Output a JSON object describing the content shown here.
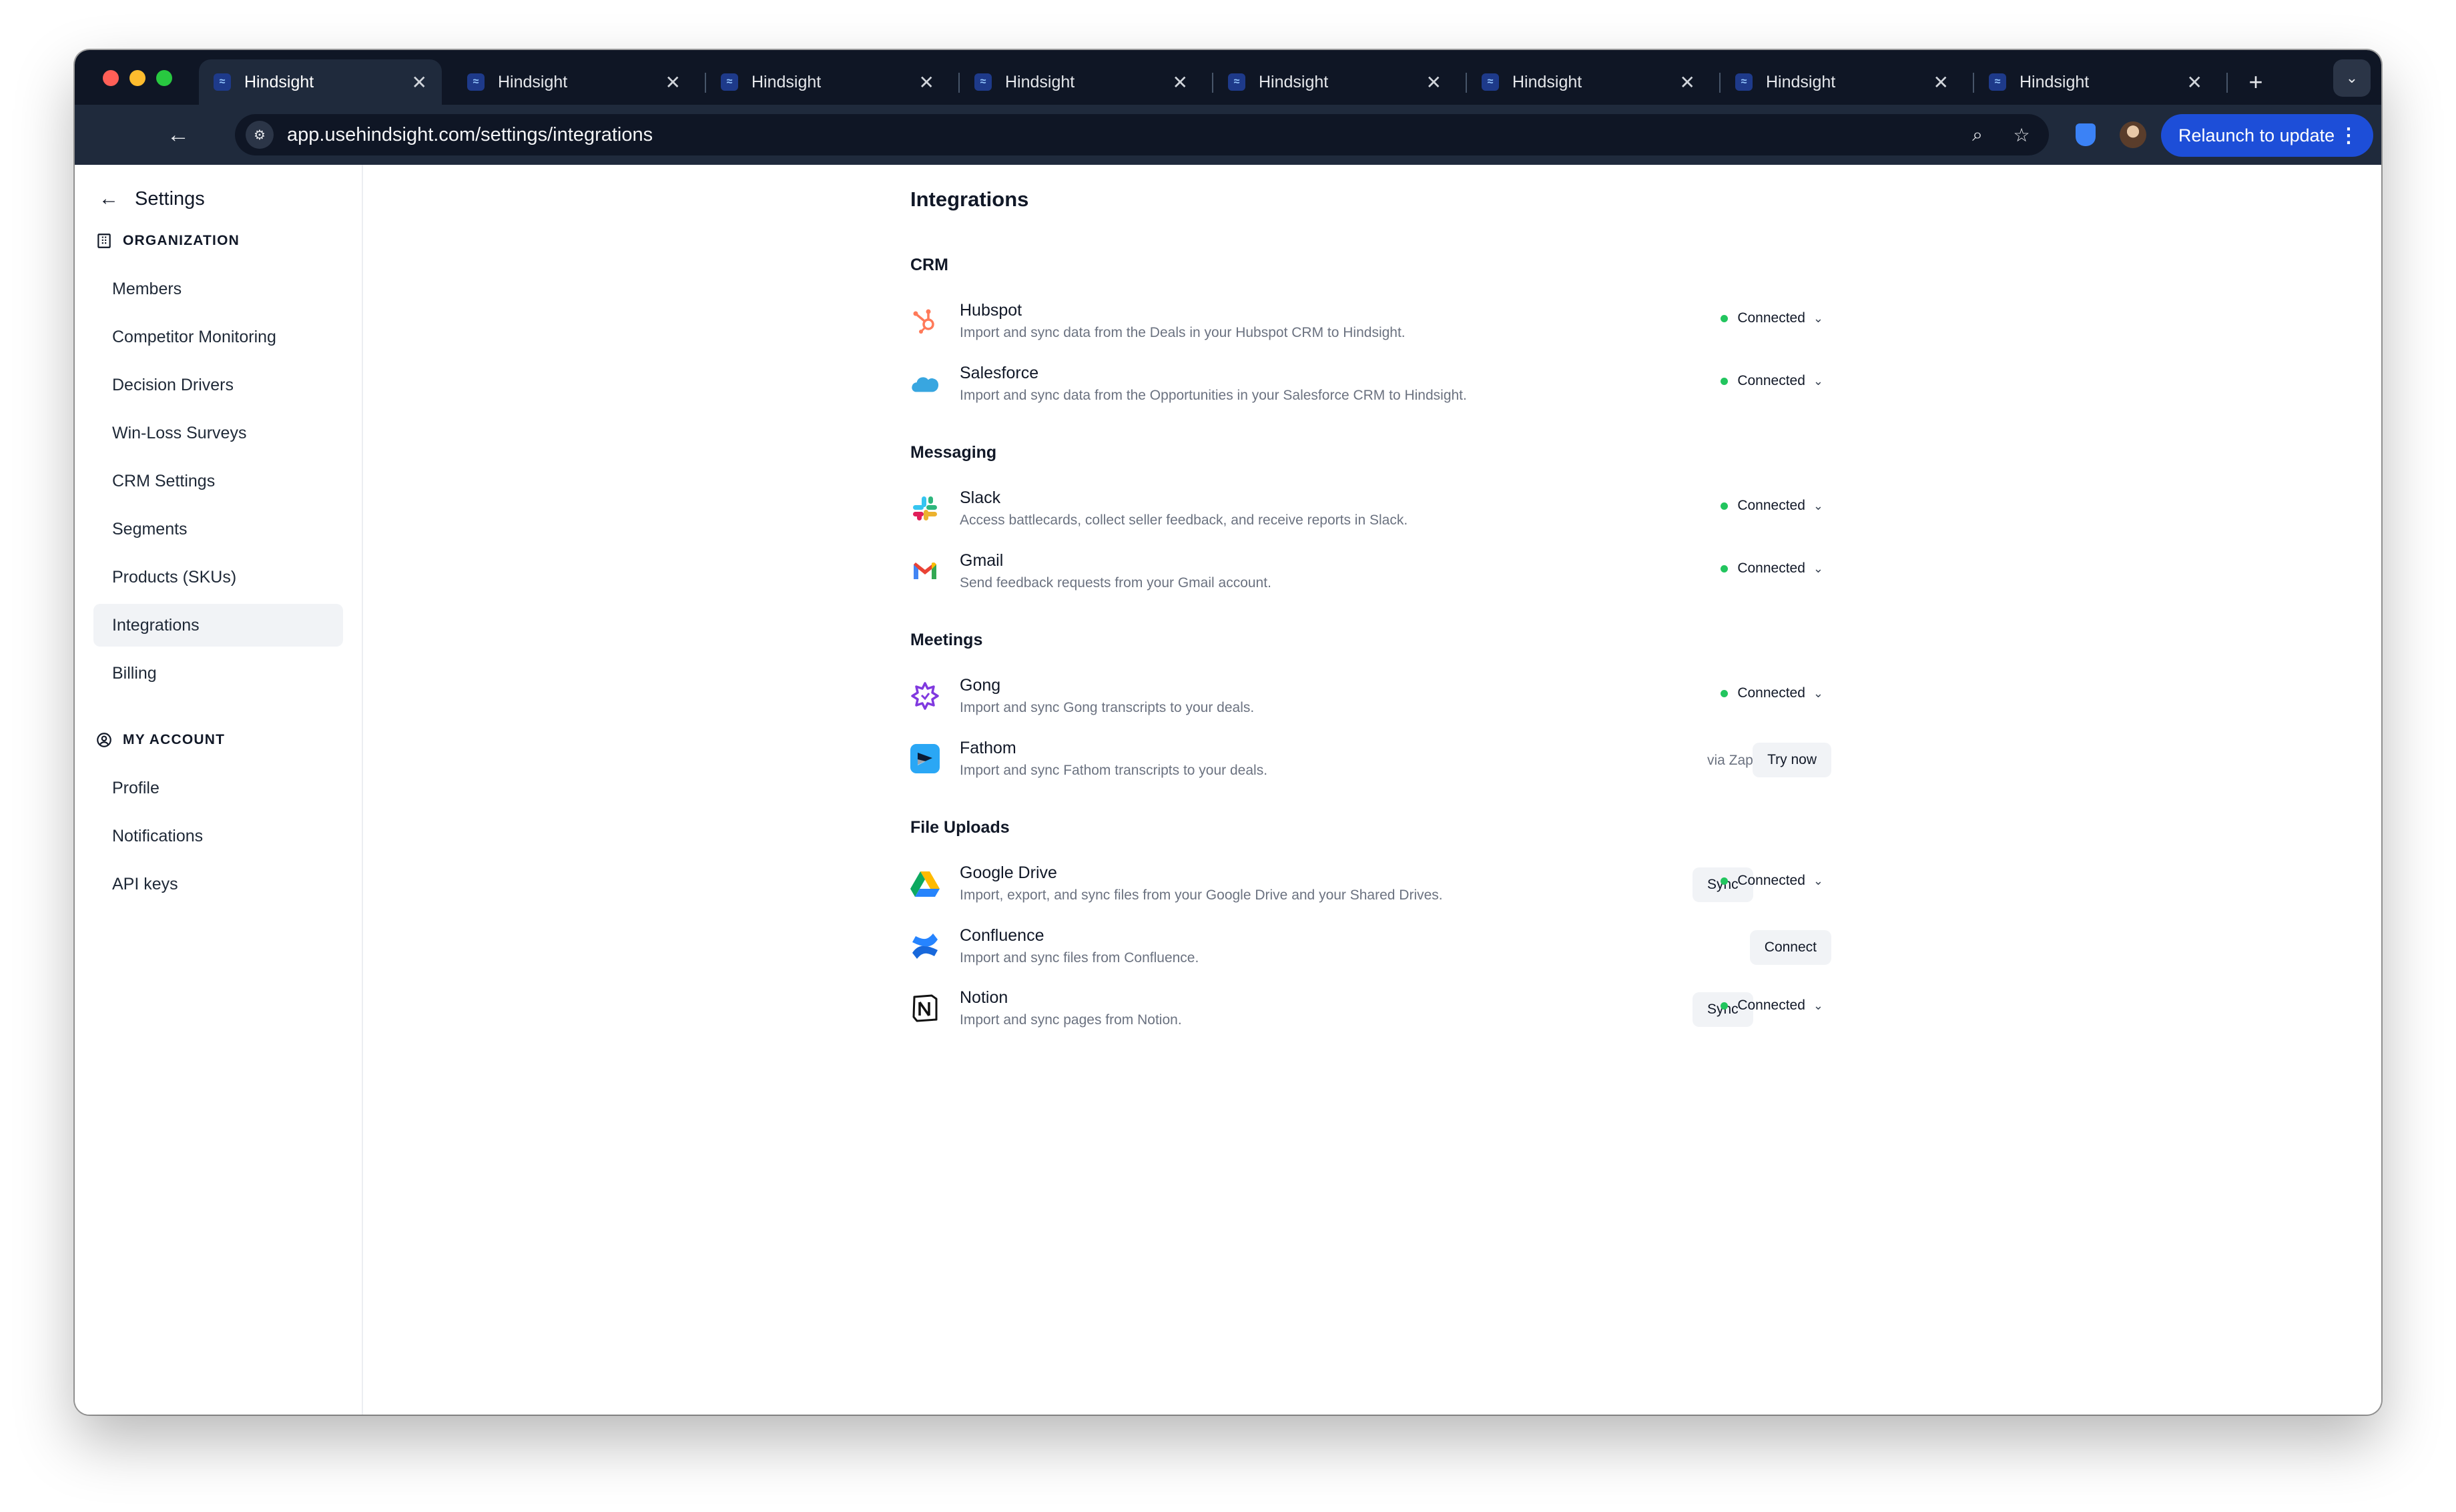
{
  "browser": {
    "tabs": [
      {
        "title": "Hindsight",
        "active": true
      },
      {
        "title": "Hindsight",
        "active": false
      },
      {
        "title": "Hindsight",
        "active": false
      },
      {
        "title": "Hindsight",
        "active": false
      },
      {
        "title": "Hindsight",
        "active": false
      },
      {
        "title": "Hindsight",
        "active": false
      },
      {
        "title": "Hindsight",
        "active": false
      },
      {
        "title": "Hindsight",
        "active": false
      }
    ],
    "tab_close_glyph": "✕",
    "new_tab_glyph": "+",
    "url": "app.usehindsight.com/settings/integrations",
    "relaunch_label": "Relaunch to update"
  },
  "sidebar": {
    "title": "Settings",
    "organization_heading": "ORGANIZATION",
    "organization_items": [
      {
        "label": "Members"
      },
      {
        "label": "Competitor Monitoring"
      },
      {
        "label": "Decision Drivers"
      },
      {
        "label": "Win-Loss Surveys"
      },
      {
        "label": "CRM Settings"
      },
      {
        "label": "Segments"
      },
      {
        "label": "Products (SKUs)"
      },
      {
        "label": "Integrations",
        "active": true
      },
      {
        "label": "Billing"
      }
    ],
    "account_heading": "MY ACCOUNT",
    "account_items": [
      {
        "label": "Profile"
      },
      {
        "label": "Notifications"
      },
      {
        "label": "API keys"
      }
    ]
  },
  "main": {
    "title": "Integrations",
    "groups": [
      {
        "title": "CRM",
        "items": [
          {
            "name": "Hubspot",
            "desc": "Import and sync data from the Deals in your Hubspot CRM to Hindsight.",
            "status": "Connected",
            "icon": "hubspot-icon"
          },
          {
            "name": "Salesforce",
            "desc": "Import and sync data from the Opportunities in your Salesforce CRM to Hindsight.",
            "status": "Connected",
            "icon": "salesforce-icon"
          }
        ]
      },
      {
        "title": "Messaging",
        "items": [
          {
            "name": "Slack",
            "desc": "Access battlecards, collect seller feedback, and receive reports in Slack.",
            "status": "Connected",
            "icon": "slack-icon"
          },
          {
            "name": "Gmail",
            "desc": "Send feedback requests from your Gmail account.",
            "status": "Connected",
            "icon": "gmail-icon"
          }
        ]
      },
      {
        "title": "Meetings",
        "items": [
          {
            "name": "Gong",
            "desc": "Import and sync Gong transcripts to your deals.",
            "status": "Connected",
            "icon": "gong-icon"
          },
          {
            "name": "Fathom",
            "desc": "Import and sync Fathom transcripts to your deals.",
            "via": "via Zapier",
            "action": "Try now",
            "icon": "fathom-icon"
          }
        ]
      },
      {
        "title": "File Uploads",
        "items": [
          {
            "name": "Google Drive",
            "desc": "Import, export, and sync files from your Google Drive and your Shared Drives.",
            "sync": "Sync",
            "status": "Connected",
            "icon": "google-drive-icon"
          },
          {
            "name": "Confluence",
            "desc": "Import and sync files from Confluence.",
            "action": "Connect",
            "icon": "confluence-icon"
          },
          {
            "name": "Notion",
            "desc": "Import and sync pages from Notion.",
            "sync": "Sync",
            "status": "Connected",
            "icon": "notion-icon"
          }
        ]
      }
    ]
  },
  "colors": {
    "tabstrip_bg": "#0f1625",
    "toolbar_bg": "#1f2a3c",
    "relaunch_bg": "#1d4ed8",
    "connected_dot": "#22c55e",
    "active_nav_bg": "#f1f3f6"
  }
}
